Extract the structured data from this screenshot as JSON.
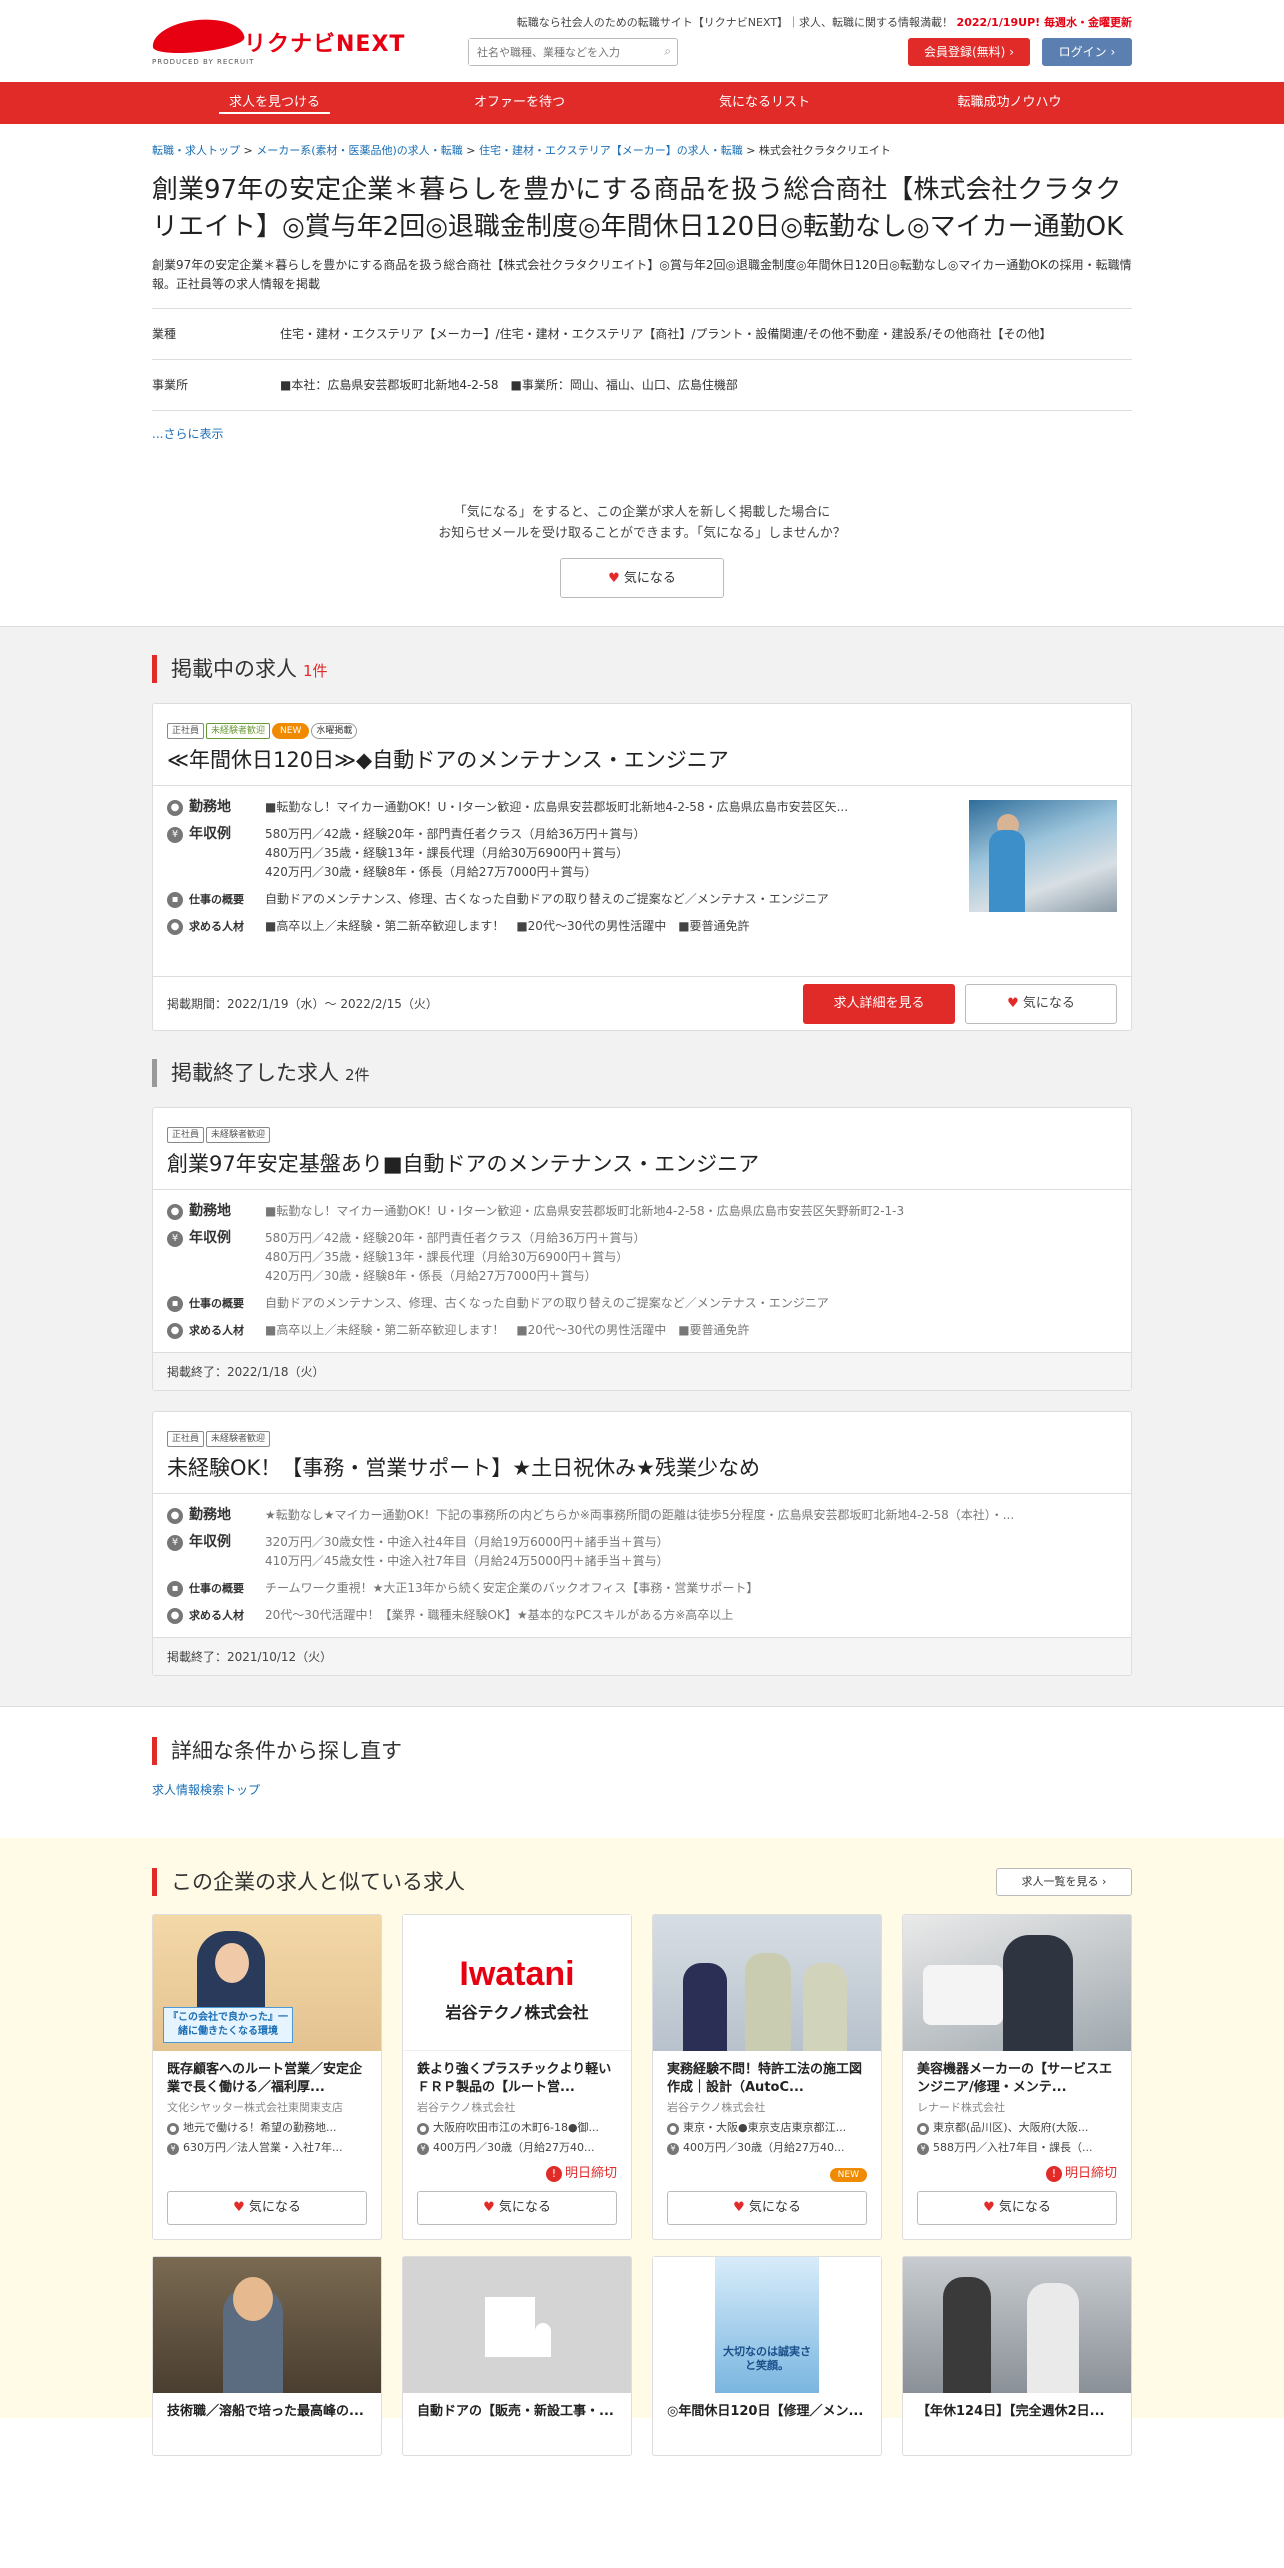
{
  "header": {
    "logo_text": "リクナビNEXT",
    "logo_sub": "PRODUCED BY RECRUIT",
    "tagline": "転職なら社会人のための転職サイト【リクナビNEXT】｜求人、転職に関する情報満載！",
    "update_notice": "2022/1/19UP! 毎週水・金曜更新",
    "search_placeholder": "社名や職種、業種などを入力",
    "register_label": "会員登録(無料)",
    "login_label": "ログイン"
  },
  "nav": [
    "求人を見つける",
    "オファーを待つ",
    "気になるリスト",
    "転職成功ノウハウ"
  ],
  "breadcrumb": [
    "転職・求人トップ",
    "メーカー系(素材・医薬品他)の求人・転職",
    "住宅・建材・エクステリア【メーカー】の求人・転職",
    "株式会社クラタクリエイト"
  ],
  "title": "創業97年の安定企業＊暮らしを豊かにする商品を扱う総合商社【株式会社クラタクリエイト】◎賞与年2回◎退職金制度◎年間休日120日◎転勤なし◎マイカー通勤OK",
  "description": "創業97年の安定企業＊暮らしを豊かにする商品を扱う総合商社【株式会社クラタクリエイト】◎賞与年2回◎退職金制度◎年間休日120日◎転勤なし◎マイカー通勤OKの採用・転職情報。正社員等の求人情報を掲載",
  "info": [
    {
      "key": "業種",
      "value": "住宅・建材・エクステリア【メーカー】/住宅・建材・エクステリア【商社】/プラント・設備関連/その他不動産・建設系/その他商社【その他】"
    },
    {
      "key": "事業所",
      "value": "■本社：広島県安芸郡坂町北新地4-2-58　■事業所：岡山、福山、山口、広島住機部"
    }
  ],
  "more_link": "...さらに表示",
  "kinaru": {
    "line1": "「気になる」をすると、この企業が求人を新しく掲載した場合に",
    "line2": "お知らせメールを受け取ることができます。「気になる」しませんか？",
    "button": "気になる"
  },
  "active": {
    "heading": "掲載中の求人",
    "count": "1件",
    "jobs": [
      {
        "tags": [
          "正社員",
          "未経験者歓迎",
          "NEW",
          "水曜掲載"
        ],
        "title": "≪年間休日120日≫◆自動ドアのメンテナンス・エンジニア",
        "location_label": "勤務地",
        "location": "■転勤なし！マイカー通勤OK！U・Iターン歓迎・広島県安芸郡坂町北新地4-2-58・広島県広島市安芸区矢...",
        "salary_label": "年収例",
        "salary": [
          "580万円／42歳・経験20年・部門責任者クラス（月給36万円＋賞与）",
          "480万円／35歳・経験13年・課長代理（月給30万6900円＋賞与）",
          "420万円／30歳・経験8年・係長（月給27万7000円＋賞与）"
        ],
        "work_label": "仕事の概要",
        "work": "自動ドアのメンテナンス、修理、古くなった自動ドアの取り替えのご提案など／メンテナス・エンジニア",
        "req_label": "求める人材",
        "req": "■高卒以上／未経験・第二新卒歓迎します！　■20代～30代の男性活躍中　■要普通免許",
        "period": "掲載期間：2022/1/19（水）～ 2022/2/15（火）",
        "detail_button": "求人詳細を見る",
        "kinaru_button": "気になる"
      }
    ]
  },
  "ended": {
    "heading": "掲載終了した求人",
    "count": "2件",
    "jobs": [
      {
        "tags": [
          "正社員",
          "未経験者歓迎"
        ],
        "title": "創業97年安定基盤あり■自動ドアのメンテナンス・エンジニア",
        "location": "■転勤なし！マイカー通勤OK！U・Iターン歓迎・広島県安芸郡坂町北新地4-2-58・広島県広島市安芸区矢野新町2-1-3",
        "salary": [
          "580万円／42歳・経験20年・部門責任者クラス（月給36万円＋賞与）",
          "480万円／35歳・経験13年・課長代理（月給30万6900円＋賞与）",
          "420万円／30歳・経験8年・係長（月給27万7000円＋賞与）"
        ],
        "work": "自動ドアのメンテナンス、修理、古くなった自動ドアの取り替えのご提案など／メンテナス・エンジニア",
        "req": "■高卒以上／未経験・第二新卒歓迎します！　■20代～30代の男性活躍中　■要普通免許",
        "ended": "掲載終了：2022/1/18（火）"
      },
      {
        "tags": [
          "正社員",
          "未経験者歓迎"
        ],
        "title": "未経験OK！【事務・営業サポート】★土日祝休み★残業少なめ",
        "location": "★転勤なし★マイカー通勤OK！下記の事務所の内どちらか※両事務所間の距離は徒歩5分程度・広島県安芸郡坂町北新地4-2-58（本社）・...",
        "salary": [
          "320万円／30歳女性・中途入社4年目（月給19万6000円＋諸手当＋賞与）",
          "410万円／45歳女性・中途入社7年目（月給24万5000円＋諸手当＋賞与）"
        ],
        "work": "チームワーク重視！★大正13年から続く安定企業のバックオフィス【事務・営業サポート】",
        "req": "20代～30代活躍中！【業界・職種未経験OK】★基本的なPCスキルがある方※高卒以上",
        "ended": "掲載終了：2021/10/12（火）"
      }
    ]
  },
  "detail_search": {
    "heading": "詳細な条件から探し直す",
    "link": "求人情報検索トップ"
  },
  "similar": {
    "heading": "この企業の求人と似ている求人",
    "list_button": "求人一覧を見る",
    "cards": [
      {
        "title": "既存顧客へのルート営業／安定企業で長く働ける／福利厚...",
        "company": "文化シヤッター株式会社東関東支店",
        "loc": "地元で働ける！希望の勤務地...",
        "sal": "630万円／法人営業・入社7年...",
        "badge": "",
        "btn": "気になる"
      },
      {
        "title": "鉄より強くプラスチックより軽いＦＲＰ製品の【ルート営...",
        "company": "岩谷テクノ株式会社",
        "loc": "大阪府吹田市江の木町6-18●御...",
        "sal": "400万円／30歳（月給27万40...",
        "badge": "明日締切",
        "btn": "気になる"
      },
      {
        "title": "実務経験不問！特許工法の施工図作成｜設計（AutoC...",
        "company": "岩谷テクノ株式会社",
        "loc": "東京・大阪●東京支店東京都江...",
        "sal": "400万円／30歳（月給27万40...",
        "badge": "NEW",
        "btn": "気になる"
      },
      {
        "title": "美容機器メーカーの【サービスエンジニア/修理・メンテ...",
        "company": "レナード株式会社",
        "loc": "東京都(品川区)、大阪府(大阪...",
        "sal": "588万円／入社7年目・課長（...",
        "badge": "明日締切",
        "btn": "気になる"
      }
    ],
    "cards2": [
      {
        "title": "技術職／溶船で培った最高峰の..."
      },
      {
        "title": "自動ドアの【販売・新設工事・..."
      },
      {
        "title": "◎年間休日120日【修理／メン..."
      },
      {
        "title": "【年休124日】【完全週休2日..."
      }
    ],
    "img_text": {
      "bunka": "『この会社で良かった』一緒に働きたくなる環境",
      "iwatani1": "Iwatani",
      "iwatani2": "岩谷テクノ株式会社",
      "ad": "大切なのは誠実さと笑顔。"
    }
  }
}
